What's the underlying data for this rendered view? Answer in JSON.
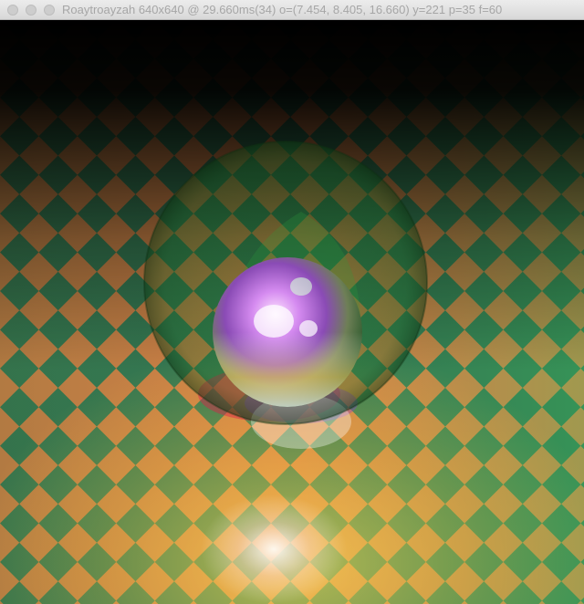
{
  "window": {
    "title": "Roaytroayzah 640x640 @ 29.660ms(34) o=(7.454, 8.405, 16.660) y=221 p=35 f=60"
  },
  "scene": {
    "floor_colors": [
      "#f07a46",
      "#2f6f55",
      "#ffd24a",
      "#6fd070"
    ],
    "sphere_highlight": "#c98ae8",
    "background": "#000000"
  }
}
